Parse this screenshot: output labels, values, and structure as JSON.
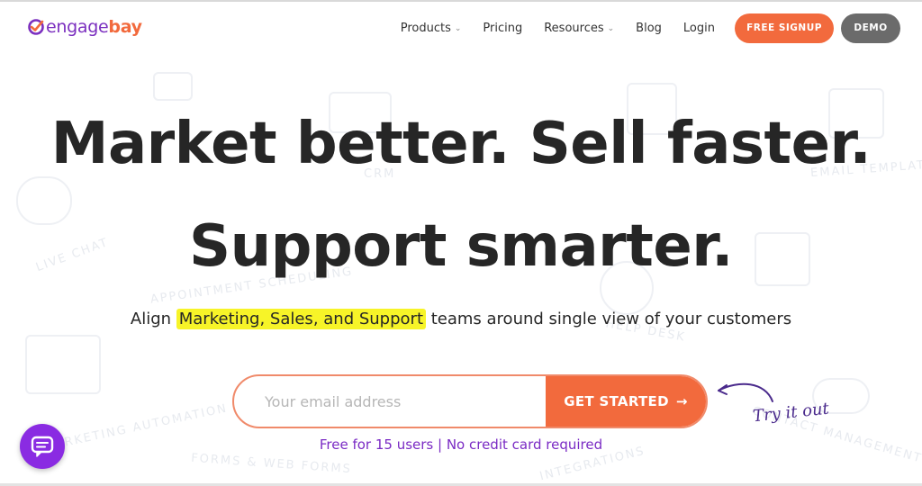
{
  "brand": {
    "logo_part1": "engage",
    "logo_part2": "bay",
    "primary_color": "#f26a3d",
    "accent_color": "#7a2bc4"
  },
  "nav": {
    "items": [
      {
        "label": "Products",
        "has_dropdown": true
      },
      {
        "label": "Pricing",
        "has_dropdown": false
      },
      {
        "label": "Resources",
        "has_dropdown": true
      },
      {
        "label": "Blog",
        "has_dropdown": false
      },
      {
        "label": "Login",
        "has_dropdown": false
      }
    ],
    "signup_label": "FREE SIGNUP",
    "demo_label": "DEMO"
  },
  "hero": {
    "headline_line1": "Market better. Sell faster.",
    "headline_line2": "Support smarter.",
    "subheadline_pre": "Align ",
    "subheadline_highlight": "Marketing, Sales, and Support",
    "subheadline_post": " teams around single view of your customers",
    "email_placeholder": "Your email address",
    "email_value": "",
    "cta_label": "GET STARTED",
    "cta_icon": "arrow-right-icon",
    "note": "Free for 15 users | No credit card required",
    "try_it_label": "Try it out"
  },
  "background_labels": [
    "CRM",
    "LIVE CHAT",
    "APPOINTMENT SCHEDULING",
    "HELP DESK",
    "MARKETING AUTOMATION",
    "FORMS & WEB FORMS",
    "INTEGRATIONS",
    "CONTACT MANAGEMENT",
    "EMAIL TEMPLATES"
  ],
  "chat_widget": {
    "icon": "chat-icon"
  }
}
